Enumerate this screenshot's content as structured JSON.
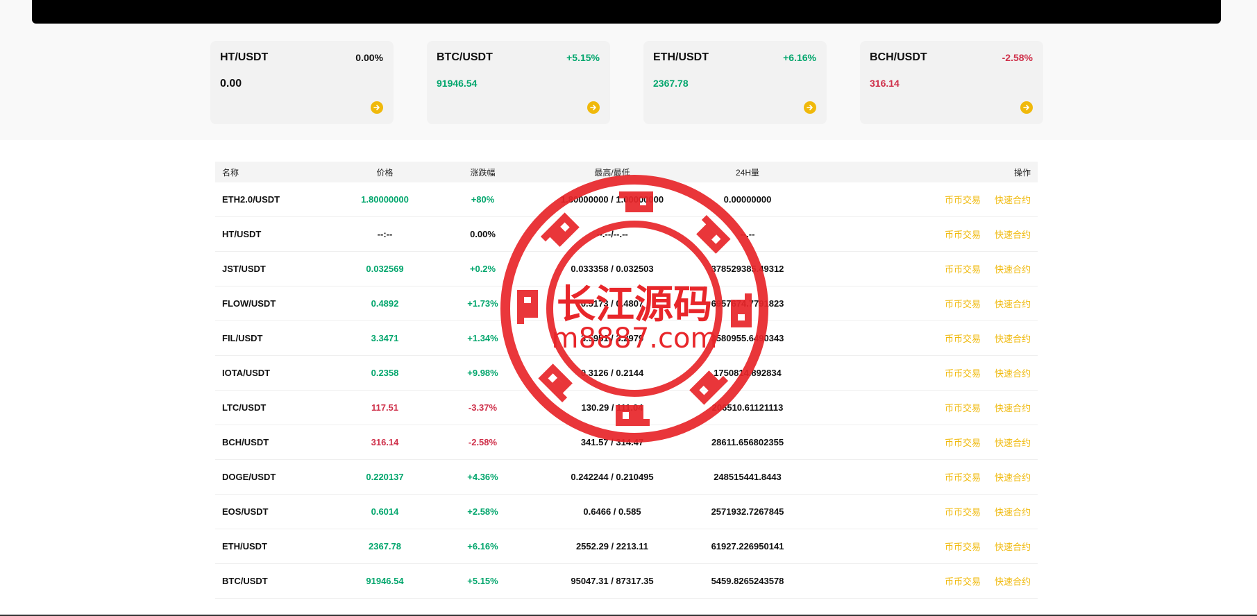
{
  "colors": {
    "up": "#03a66d",
    "down": "#cf304a",
    "accent": "#f0b90b"
  },
  "cards": [
    {
      "symbol": "HT/USDT",
      "change": "0.00%",
      "price": "0.00",
      "trend": "neutral",
      "arrow_icon": "arrow-right-circle-icon"
    },
    {
      "symbol": "BTC/USDT",
      "change": "+5.15%",
      "price": "91946.54",
      "trend": "green",
      "arrow_icon": "arrow-right-circle-icon"
    },
    {
      "symbol": "ETH/USDT",
      "change": "+6.16%",
      "price": "2367.78",
      "trend": "green",
      "arrow_icon": "arrow-right-circle-icon"
    },
    {
      "symbol": "BCH/USDT",
      "change": "-2.58%",
      "price": "316.14",
      "trend": "red",
      "arrow_icon": "arrow-right-circle-icon"
    }
  ],
  "table": {
    "headers": {
      "name": "名称",
      "price": "价格",
      "change": "涨跌幅",
      "high_low": "最高/最低",
      "volume": "24H量",
      "ops": "操作"
    },
    "op_spot": "币币交易",
    "op_contract": "快速合约",
    "rows": [
      {
        "name": "ETH2.0/USDT",
        "price": "1.80000000",
        "change": "+80%",
        "high_low": "1.80000000 / 1.00000000",
        "volume": "0.00000000",
        "trend": "green"
      },
      {
        "name": "HT/USDT",
        "price": "--:--",
        "change": "0.00%",
        "high_low": "--.--/--.--",
        "volume": "--.--",
        "trend": "neutral"
      },
      {
        "name": "JST/USDT",
        "price": "0.032569",
        "change": "+0.2%",
        "high_low": "0.033358 / 0.032503",
        "volume": "378529385.49312",
        "trend": "green"
      },
      {
        "name": "FLOW/USDT",
        "price": "0.4892",
        "change": "+1.73%",
        "high_low": "0.5173 / 0.4807",
        "volume": "6957674.7791823",
        "trend": "green"
      },
      {
        "name": "FIL/USDT",
        "price": "3.3471",
        "change": "+1.34%",
        "high_low": "3.5951 / 3.2979",
        "volume": "3580955.6490343",
        "trend": "green"
      },
      {
        "name": "IOTA/USDT",
        "price": "0.2358",
        "change": "+9.98%",
        "high_low": "0.3126 / 0.2144",
        "volume": "1750814.892834",
        "trend": "green"
      },
      {
        "name": "LTC/USDT",
        "price": "117.51",
        "change": "-3.37%",
        "high_low": "130.29 / 111.04",
        "volume": "206510.61121113",
        "trend": "red"
      },
      {
        "name": "BCH/USDT",
        "price": "316.14",
        "change": "-2.58%",
        "high_low": "341.57 / 314.47",
        "volume": "28611.656802355",
        "trend": "red"
      },
      {
        "name": "DOGE/USDT",
        "price": "0.220137",
        "change": "+4.36%",
        "high_low": "0.242244 / 0.210495",
        "volume": "248515441.8443",
        "trend": "green"
      },
      {
        "name": "EOS/USDT",
        "price": "0.6014",
        "change": "+2.58%",
        "high_low": "0.6466 / 0.585",
        "volume": "2571932.7267845",
        "trend": "green"
      },
      {
        "name": "ETH/USDT",
        "price": "2367.78",
        "change": "+6.16%",
        "high_low": "2552.29 / 2213.11",
        "volume": "61927.226950141",
        "trend": "green"
      },
      {
        "name": "BTC/USDT",
        "price": "91946.54",
        "change": "+5.15%",
        "high_low": "95047.31 / 87317.35",
        "volume": "5459.8265243578",
        "trend": "green"
      }
    ]
  },
  "watermark": {
    "title": "长江源码",
    "url": "m8887.com"
  }
}
